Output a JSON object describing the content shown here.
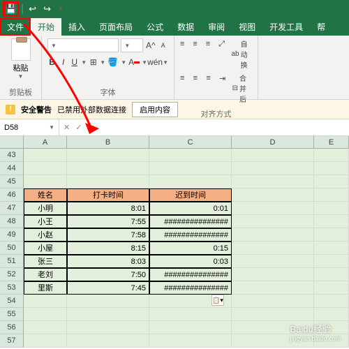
{
  "qat": {
    "undo": "↩",
    "redo": "↪"
  },
  "menu": {
    "file": "文件",
    "home": "开始",
    "insert": "插入",
    "layout": "页面布局",
    "formula": "公式",
    "data": "数据",
    "review": "审阅",
    "view": "视图",
    "dev": "开发工具",
    "help": "帮"
  },
  "ribbon": {
    "clipboard": {
      "paste": "粘贴",
      "label": "剪贴板"
    },
    "font": {
      "label": "字体",
      "sizeUp": "A",
      "sizeDown": "A",
      "bold": "B",
      "italic": "I",
      "underline": "U"
    },
    "align": {
      "label": "对齐方式",
      "wrap": "自动换",
      "merge": "合并后"
    }
  },
  "security": {
    "title": "安全警告",
    "msg": "已禁用外部数据连接",
    "enable": "启用内容"
  },
  "namebox": "D58",
  "cols": [
    "A",
    "B",
    "C",
    "D",
    "E"
  ],
  "rowsEmpty": [
    "43",
    "44",
    "45"
  ],
  "headers": {
    "name": "姓名",
    "clock": "打卡时间",
    "late": "迟到时间"
  },
  "data": [
    {
      "r": "47",
      "name": "小明",
      "clock": "8:01",
      "late": "0:01"
    },
    {
      "r": "48",
      "name": "小王",
      "clock": "7:55",
      "late": "###############"
    },
    {
      "r": "49",
      "name": "小赵",
      "clock": "7:58",
      "late": "###############"
    },
    {
      "r": "50",
      "name": "小屋",
      "clock": "8:15",
      "late": "0:15"
    },
    {
      "r": "51",
      "name": "张三",
      "clock": "8:03",
      "late": "0:03"
    },
    {
      "r": "52",
      "name": "老刘",
      "clock": "7:50",
      "late": "###############"
    },
    {
      "r": "53",
      "name": "里斯",
      "clock": "7:45",
      "late": "###############"
    }
  ],
  "rowsAfter": [
    "54",
    "55",
    "56",
    "57"
  ],
  "watermark": {
    "brand": "Baidu经验",
    "url": "jingyan.baidu.com"
  }
}
